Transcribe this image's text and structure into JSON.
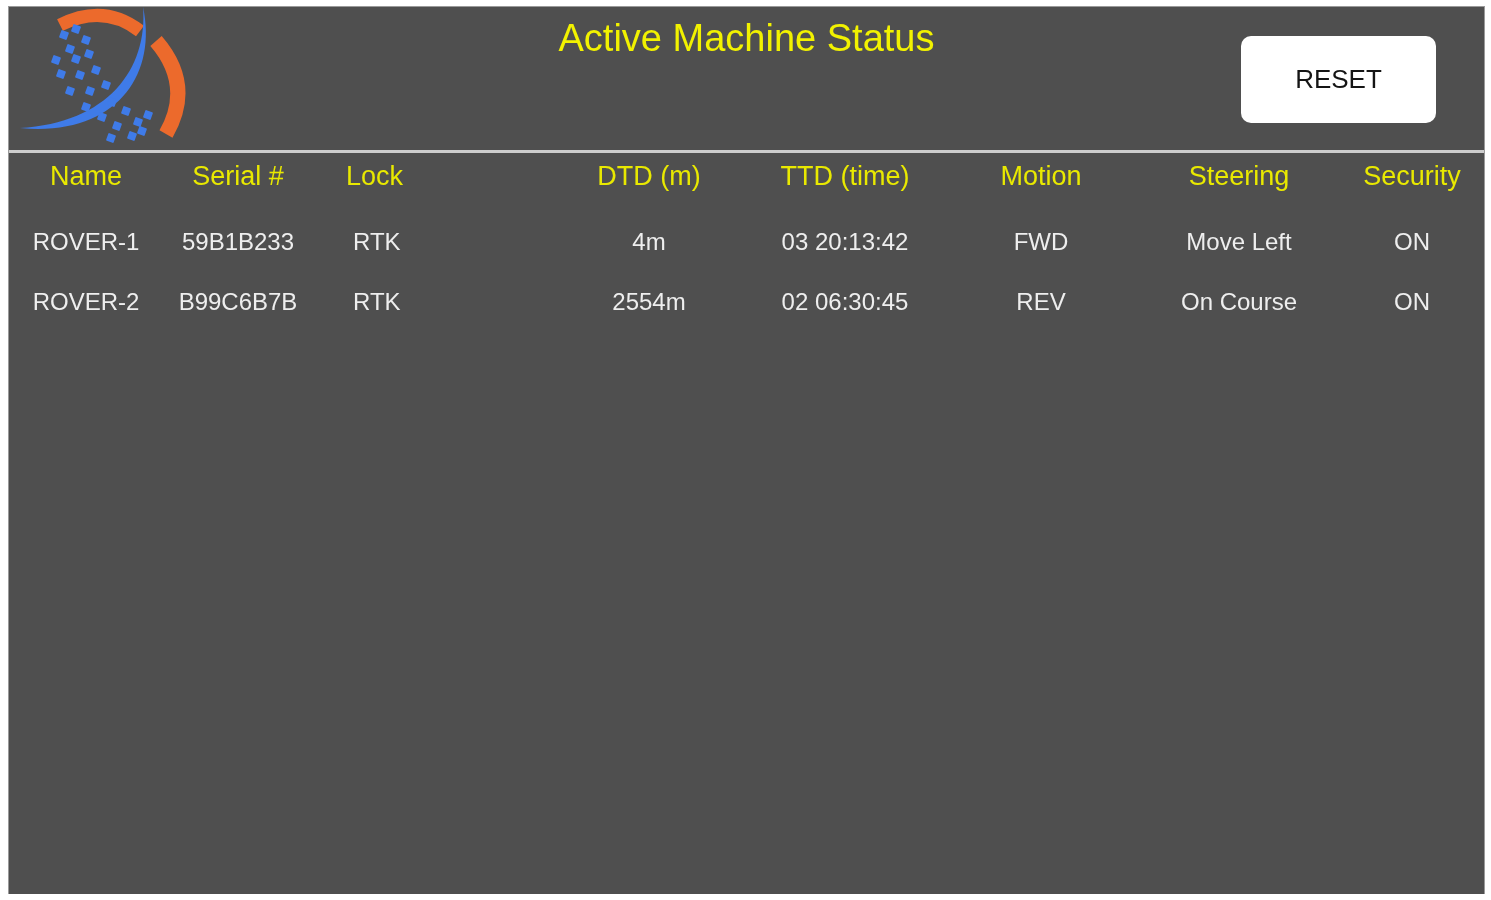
{
  "header": {
    "title": "Active Machine Status",
    "button": "RESET"
  },
  "table": {
    "columns": [
      "Name",
      "Serial #",
      "Lock",
      "DTD (m)",
      "TTD (time)",
      "Motion",
      "Steering",
      "Security"
    ],
    "rows": [
      [
        "ROVER-1",
        "59B1B233",
        "RTK",
        "4m",
        "03 20:13:42",
        "FWD",
        "Move Left",
        "ON"
      ],
      [
        "ROVER-2",
        "B99C6B7B",
        "RTK",
        "2554m",
        "02 06:30:45",
        "REV",
        "On Course",
        "ON"
      ]
    ]
  }
}
